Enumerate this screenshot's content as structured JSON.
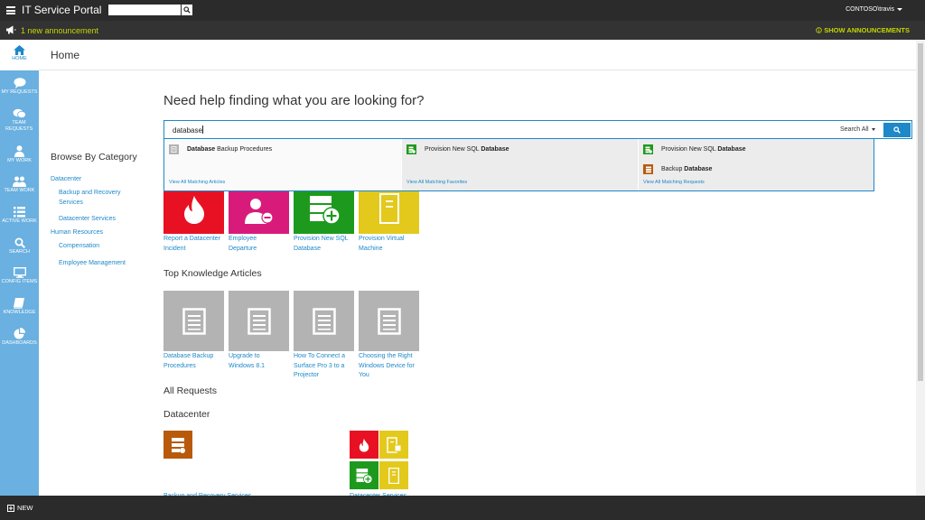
{
  "topbar": {
    "title": "IT Service Portal",
    "search_value": "",
    "user": "CONTOSO\\travis"
  },
  "announcement": {
    "text": "1 new announcement",
    "show_label": "SHOW ANNOUNCEMENTS"
  },
  "nav": {
    "home": "HOME",
    "my_requests": "MY REQUESTS",
    "team_requests": "TEAM REQUESTS",
    "my_work": "MY WORK",
    "team_work": "TEAM WORK",
    "active_work": "ACTIVE WORK",
    "search": "SEARCH",
    "config_items": "CONFIG ITEMS",
    "knowledge": "KNOWLEDGE",
    "dashboards": "DASHBOARDS"
  },
  "page": {
    "title": "Home",
    "help_heading": "Need help finding what you are looking for?"
  },
  "search": {
    "value": "database",
    "scope": "Search All"
  },
  "dropdown": {
    "articles": {
      "items": [
        {
          "bold": "Database",
          "rest": " Backup Procedures"
        }
      ],
      "footer": "View All Matching Articles"
    },
    "favorites": {
      "items": [
        {
          "pre": "Provision New SQL ",
          "bold": "Database"
        }
      ],
      "footer": "View All Matching Favorites"
    },
    "requests": {
      "items": [
        {
          "pre": "Provision New SQL ",
          "bold": "Database"
        },
        {
          "pre": "Backup ",
          "bold": "Database"
        }
      ],
      "footer": "View All Matching Requests"
    }
  },
  "browse": {
    "title": "Browse By Category",
    "items": [
      {
        "label": "Datacenter",
        "level": 0
      },
      {
        "label": "Backup and Recovery Services",
        "level": 1
      },
      {
        "label": "Datacenter Services",
        "level": 1
      },
      {
        "label": "Human Resources",
        "level": 0
      },
      {
        "label": "Compensation",
        "level": 1
      },
      {
        "label": "Employee Management",
        "level": 1
      }
    ]
  },
  "favorites_tiles": [
    {
      "label": "Report a Datacenter Incident",
      "color": "#e81123"
    },
    {
      "label": "Employee Departure",
      "color": "#d81b7b"
    },
    {
      "label": "Provision New SQL Database",
      "color": "#1d9a1d"
    },
    {
      "label": "Provision Virtual Machine",
      "color": "#e3c91c"
    }
  ],
  "knowledge": {
    "title": "Top Knowledge Articles",
    "tiles": [
      {
        "label": "Database Backup Procedures"
      },
      {
        "label": "Upgrade to Windows 8.1"
      },
      {
        "label": "How To Connect a Surface Pro 3 to a Projector"
      },
      {
        "label": "Choosing the Right Windows Device for You"
      }
    ]
  },
  "all_requests": {
    "title": "All Requests",
    "group": "Datacenter",
    "clipped_1": "Backup and Recovery Services",
    "clipped_2": "Datacenter Services"
  },
  "bottom": {
    "new_label": "NEW"
  },
  "colors": {
    "accent": "#1e88c8",
    "nav": "#6ab0e0",
    "announcement": "#c4d600",
    "knowledge_tile": "#b3b3b3",
    "backup_tile": "#b85a0a"
  }
}
